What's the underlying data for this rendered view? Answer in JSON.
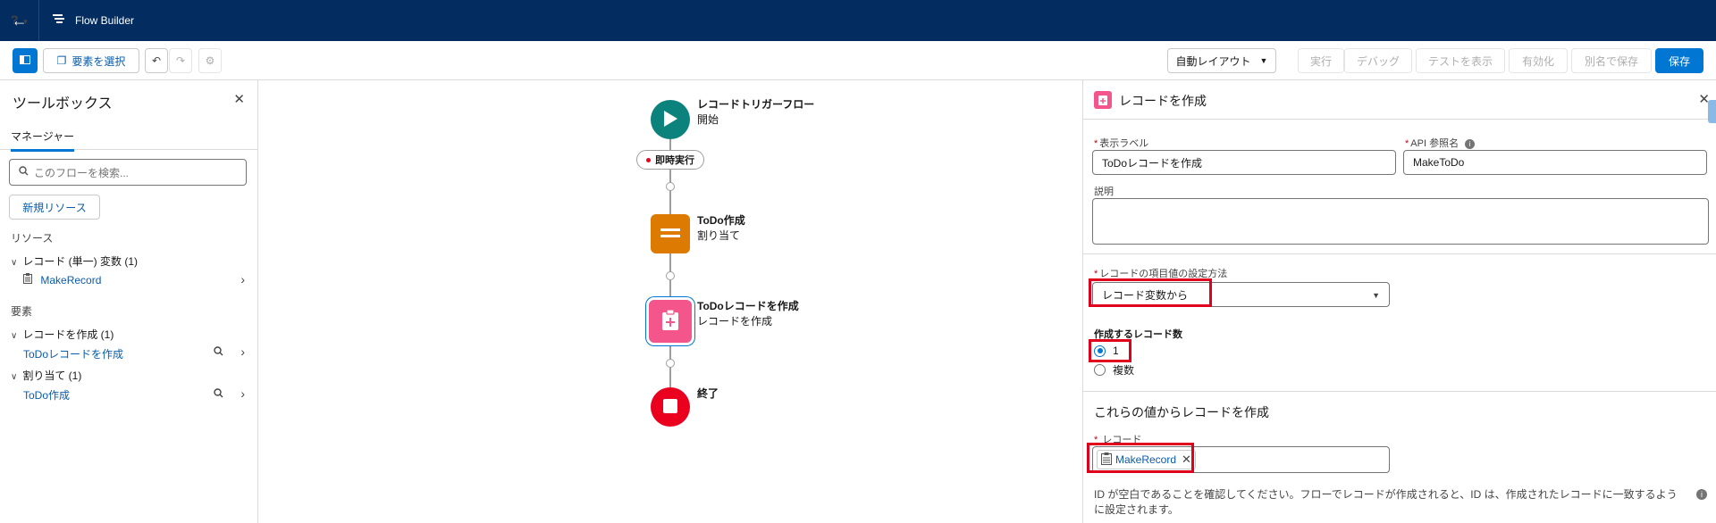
{
  "topbar": {
    "back_icon": "←",
    "logo_icon": "flow-icon",
    "title": "Flow Builder",
    "help": "?"
  },
  "toolbar": {
    "toggle_icon": "panel-icon",
    "select_elements": "要素を選択",
    "undo": "↶",
    "redo": "↷",
    "settings": "⚙",
    "auto_layout": "自動レイアウト",
    "run": "実行",
    "debug": "デバッグ",
    "show_tests": "テストを表示",
    "activate": "有効化",
    "save_as": "別名で保存",
    "save": "保存"
  },
  "toolbox": {
    "title": "ツールボックス",
    "tab_manager": "マネージャー",
    "search_placeholder": "このフローを検索...",
    "new_resource": "新規リソース",
    "resources_header": "リソース",
    "record_var_group": "レコード (単一) 変数 (1)",
    "record_var_item": "MakeRecord",
    "elements_header": "要素",
    "create_group": "レコードを作成 (1)",
    "create_item": "ToDoレコードを作成",
    "assign_group": "割り当て (1)",
    "assign_item": "ToDo作成"
  },
  "canvas": {
    "start_title": "レコードトリガーフロー",
    "start_sub": "開始",
    "run_immediately": "即時実行",
    "assign_title": "ToDo作成",
    "assign_sub": "割り当て",
    "create_title": "ToDoレコードを作成",
    "create_sub": "レコードを作成",
    "end_title": "終了"
  },
  "panel": {
    "title": "レコードを作成",
    "label_field": "表示ラベル",
    "label_value": "ToDoレコードを作成",
    "api_field": "API 参照名",
    "api_value": "MakeToDo",
    "desc_field": "説明",
    "method_field": "レコードの項目値の設定方法",
    "method_value": "レコード変数から",
    "count_field": "作成するレコード数",
    "count_one": "1",
    "count_many": "複数",
    "values_section": "これらの値からレコードを作成",
    "record_field": "レコード",
    "record_value": "MakeRecord",
    "help_text": "ID が空白であることを確認してください。フローでレコードが作成されると、ID は、作成されたレコードに一致するように設定されます。"
  }
}
